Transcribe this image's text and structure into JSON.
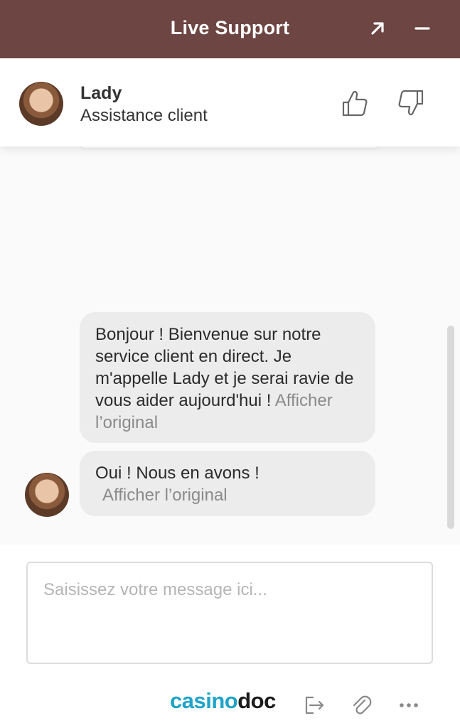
{
  "window": {
    "title": "Live Support"
  },
  "agent": {
    "name": "Lady",
    "role": "Assistance client"
  },
  "icons": {
    "expand": "arrow-up-right-icon",
    "minimize": "minimize-icon",
    "thumbs_up": "thumbs-up-icon",
    "thumbs_down": "thumbs-down-icon",
    "exit": "exit-chat-icon",
    "attach": "paperclip-icon",
    "more": "more-dots-icon"
  },
  "messages": [
    {
      "text": "Bonjour ! Bienvenue sur notre service client en direct. Je m'appelle Lady et je serai ravie de vous aider aujourd'hui ! ",
      "original_link": "Afficher l’original"
    },
    {
      "text": "Oui ! Nous en avons ! ",
      "original_link": "Afficher l’original"
    }
  ],
  "composer": {
    "placeholder": "Saisissez votre message ici..."
  },
  "branding": {
    "part1": "casino",
    "part2": "doc"
  },
  "colors": {
    "header": "#6d4542",
    "bubble": "#ececed",
    "brand_blue": "#1fa3c9"
  }
}
